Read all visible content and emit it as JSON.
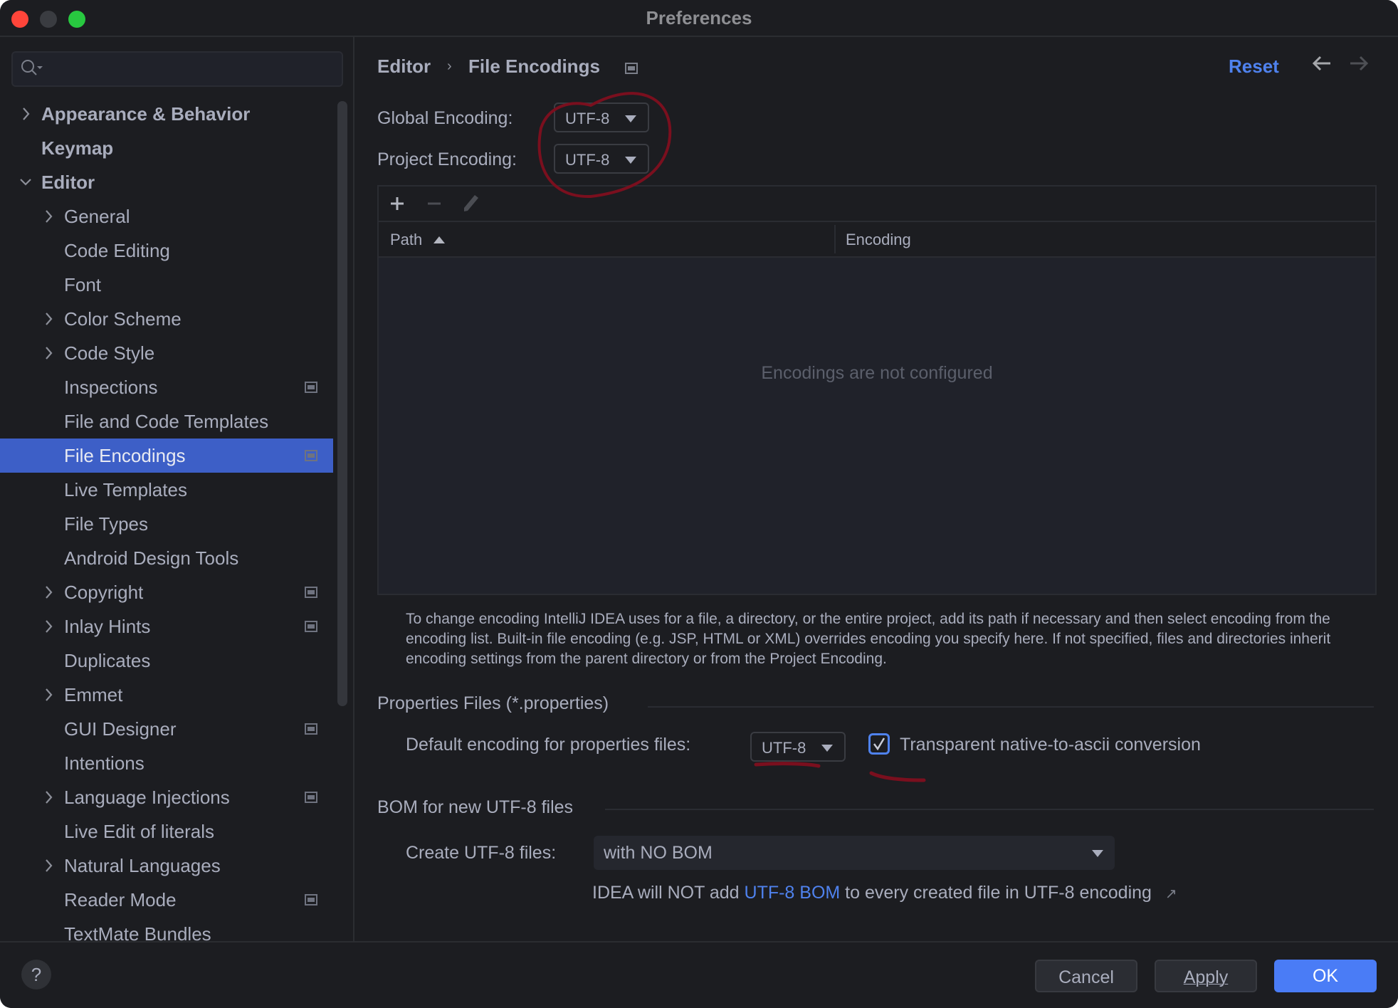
{
  "window": {
    "title": "Preferences"
  },
  "sidebar": {
    "search_placeholder": "",
    "items": [
      {
        "label": "Appearance & Behavior",
        "level": 0,
        "expandable": true,
        "expanded": false,
        "badge": false
      },
      {
        "label": "Keymap",
        "level": 0,
        "expandable": false,
        "badge": false
      },
      {
        "label": "Editor",
        "level": 0,
        "expandable": true,
        "expanded": true,
        "badge": false
      },
      {
        "label": "General",
        "level": 1,
        "expandable": true,
        "badge": false
      },
      {
        "label": "Code Editing",
        "level": 1,
        "expandable": false,
        "badge": false
      },
      {
        "label": "Font",
        "level": 1,
        "expandable": false,
        "badge": false
      },
      {
        "label": "Color Scheme",
        "level": 1,
        "expandable": true,
        "badge": false
      },
      {
        "label": "Code Style",
        "level": 1,
        "expandable": true,
        "badge": false
      },
      {
        "label": "Inspections",
        "level": 1,
        "expandable": false,
        "badge": true
      },
      {
        "label": "File and Code Templates",
        "level": 1,
        "expandable": false,
        "badge": false
      },
      {
        "label": "File Encodings",
        "level": 1,
        "expandable": false,
        "badge": true,
        "selected": true
      },
      {
        "label": "Live Templates",
        "level": 1,
        "expandable": false,
        "badge": false
      },
      {
        "label": "File Types",
        "level": 1,
        "expandable": false,
        "badge": false
      },
      {
        "label": "Android Design Tools",
        "level": 1,
        "expandable": false,
        "badge": false
      },
      {
        "label": "Copyright",
        "level": 1,
        "expandable": true,
        "badge": true
      },
      {
        "label": "Inlay Hints",
        "level": 1,
        "expandable": true,
        "badge": true
      },
      {
        "label": "Duplicates",
        "level": 1,
        "expandable": false,
        "badge": false
      },
      {
        "label": "Emmet",
        "level": 1,
        "expandable": true,
        "badge": false
      },
      {
        "label": "GUI Designer",
        "level": 1,
        "expandable": false,
        "badge": true
      },
      {
        "label": "Intentions",
        "level": 1,
        "expandable": false,
        "badge": false
      },
      {
        "label": "Language Injections",
        "level": 1,
        "expandable": true,
        "badge": true
      },
      {
        "label": "Live Edit of literals",
        "level": 1,
        "expandable": false,
        "badge": false
      },
      {
        "label": "Natural Languages",
        "level": 1,
        "expandable": true,
        "badge": false
      },
      {
        "label": "Reader Mode",
        "level": 1,
        "expandable": false,
        "badge": true
      },
      {
        "label": "TextMate Bundles",
        "level": 1,
        "expandable": false,
        "badge": false
      }
    ]
  },
  "header": {
    "breadcrumb": [
      "Editor",
      "File Encodings"
    ],
    "breadcrumb_sep": "›",
    "reset_label": "Reset",
    "back_icon": "arrow-left-icon",
    "forward_icon": "arrow-right-icon"
  },
  "encodings": {
    "global_label": "Global Encoding:",
    "global_value": "UTF-8",
    "project_label": "Project Encoding:",
    "project_value": "UTF-8"
  },
  "table": {
    "toolbar": [
      "add-icon",
      "remove-icon",
      "edit-icon"
    ],
    "columns": [
      "Path",
      "Encoding"
    ],
    "sort_column": "Path",
    "sort_direction": "ascending",
    "rows": [],
    "empty_text": "Encodings are not configured"
  },
  "help_text": "To change encoding IntelliJ IDEA uses for a file, a directory, or the entire project, add its path if necessary and then select encoding from the encoding list. Built-in file encoding (e.g. JSP, HTML or XML) overrides encoding you specify here. If not specified, files and directories inherit encoding settings from the parent directory or from the Project Encoding.",
  "properties": {
    "section_title": "Properties Files (*.properties)",
    "default_label": "Default encoding for properties files:",
    "default_value": "UTF-8",
    "transparent_label": "Transparent native-to-ascii conversion",
    "transparent_checked": true
  },
  "bom": {
    "section_title": "BOM for new UTF-8 files",
    "create_label": "Create UTF-8 files:",
    "create_value": "with NO BOM",
    "note_prefix": "IDEA will NOT add ",
    "note_link": "UTF-8 BOM",
    "note_suffix": " to every created file in UTF-8 encoding",
    "note_icon": "↗"
  },
  "footer": {
    "help_label": "?",
    "cancel_label": "Cancel",
    "apply_label": "Apply",
    "ok_label": "OK"
  },
  "colors": {
    "accent": "#4a7cf6",
    "selection": "#3d5fc7",
    "link": "#4f82ee",
    "annotation": "#7a0f1e",
    "background": "#1c1d21"
  }
}
